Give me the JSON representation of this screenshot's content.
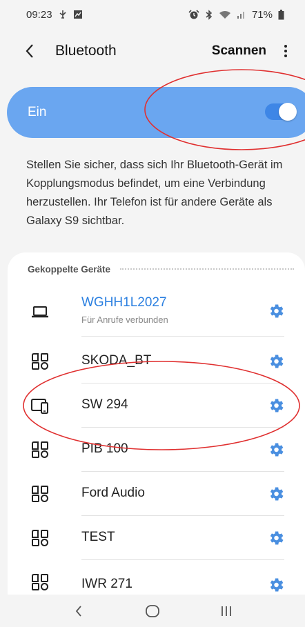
{
  "status_bar": {
    "time": "09:23",
    "battery": "71%",
    "left_icons": [
      "usb-debug-icon",
      "image-notification-icon"
    ],
    "right_icons": [
      "alarm-icon",
      "bluetooth-icon",
      "wifi-icon",
      "signal-icon",
      "battery-icon"
    ]
  },
  "header": {
    "title": "Bluetooth",
    "scan_label": "Scannen"
  },
  "toggle": {
    "label": "Ein",
    "state": true
  },
  "info_text": "Stellen Sie sicher, dass sich Ihr Bluetooth-Gerät im Kopplungsmodus befindet, um eine Verbindung herzustellen. Ihr Telefon ist für andere Geräte als Galaxy S9 sichtbar.",
  "paired": {
    "section_title": "Gekoppelte Geräte",
    "devices": [
      {
        "name": "WGHH1L2027",
        "status": "Für Anrufe verbunden",
        "icon": "laptop-icon",
        "connected": true
      },
      {
        "name": "SKODA_BT",
        "status": "",
        "icon": "generic-device-icon",
        "connected": false
      },
      {
        "name": "SW 294",
        "status": "",
        "icon": "phone-tablet-icon",
        "connected": false
      },
      {
        "name": "PIB 100",
        "status": "",
        "icon": "generic-device-icon",
        "connected": false
      },
      {
        "name": "Ford Audio",
        "status": "",
        "icon": "generic-device-icon",
        "connected": false
      },
      {
        "name": "TEST",
        "status": "",
        "icon": "generic-device-icon",
        "connected": false
      },
      {
        "name": "IWR 271",
        "status": "",
        "icon": "generic-device-icon",
        "connected": false
      }
    ]
  },
  "navbar": {
    "buttons": [
      "back-nav-icon",
      "home-nav-icon",
      "recents-nav-icon"
    ]
  },
  "colors": {
    "accent": "#3e86e6",
    "toggle_bar": "#6aa6f0",
    "connected_text": "#2a7fe0",
    "gear": "#4a8fe0",
    "annotation": "#e03030"
  }
}
